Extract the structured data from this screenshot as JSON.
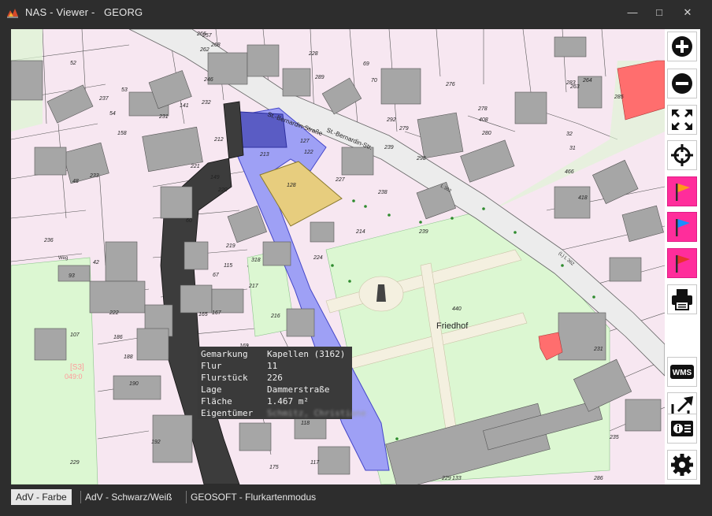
{
  "window": {
    "title": "NAS - Viewer -   GEORG",
    "minimize_glyph": "—",
    "maximize_glyph": "□",
    "close_glyph": "✕"
  },
  "map": {
    "street_label_1": "St.-Bernardin-Straße",
    "street_label_2": "St.-Bernardin-Str.",
    "road_label_1": "L 362",
    "road_label_2": "(L) L 362",
    "place_label": "Friedhof",
    "path_label": "Weg",
    "old_parcel_label_1": "[S3]",
    "old_parcel_label_2": "049:0",
    "parcel_numbers": [
      "266",
      "257",
      "268",
      "262",
      "52",
      "228",
      "69",
      "289",
      "237",
      "70",
      "276",
      "283",
      "264",
      "53",
      "246",
      "232",
      "141",
      "231",
      "279",
      "278",
      "408",
      "263",
      "285",
      "239",
      "298",
      "212",
      "127",
      "292",
      "280",
      "54",
      "158",
      "213",
      "122",
      "32",
      "31",
      "221",
      "149",
      "227",
      "238",
      "466",
      "233",
      "128",
      "220",
      "418",
      "48",
      "60",
      "239",
      "214",
      "236",
      "219",
      "318",
      "224",
      "42",
      "93",
      "115",
      "67",
      "217",
      "440",
      "222",
      "186",
      "165",
      "167",
      "216",
      "107",
      "188",
      "169",
      "231",
      "190",
      "126",
      "118",
      "192",
      "117",
      "175",
      "229",
      "229",
      "235",
      "286",
      "133"
    ]
  },
  "info_panel": {
    "rows": [
      {
        "key": "Gemarkung",
        "value": "Kapellen (3162)"
      },
      {
        "key": "Flur",
        "value": "11"
      },
      {
        "key": "Flurstück",
        "value": "226"
      },
      {
        "key": "Lage",
        "value": "Dammerstraße"
      },
      {
        "key": "Fläche",
        "value": "1.467 m²"
      },
      {
        "key": "Eigentümer",
        "value": "Schmitz, Christiane"
      }
    ]
  },
  "toolbar": {
    "buttons": [
      {
        "name": "zoom-in",
        "icon": "plus-circle-icon"
      },
      {
        "name": "zoom-out",
        "icon": "minus-circle-icon"
      },
      {
        "name": "full-extent",
        "icon": "expand-arrows-icon"
      },
      {
        "name": "locate",
        "icon": "crosshair-icon"
      },
      {
        "name": "flag-orange",
        "icon": "flag-icon",
        "color": "#ff9a1a"
      },
      {
        "name": "flag-blue",
        "icon": "flag-icon",
        "color": "#1a8cff"
      },
      {
        "name": "flag-red",
        "icon": "flag-icon",
        "color": "#e8332b"
      },
      {
        "name": "print",
        "icon": "printer-icon"
      },
      {
        "name": "wms",
        "icon": "wms-icon",
        "label": "WMS"
      },
      {
        "name": "export",
        "icon": "share-arrow-icon"
      },
      {
        "name": "info",
        "icon": "info-card-icon"
      },
      {
        "name": "settings",
        "icon": "gear-icon"
      }
    ]
  },
  "status": {
    "tabs": [
      "AdV - Farbe",
      "AdV - Schwarz/Weiß",
      "GEOSOFT - Flurkartenmodus"
    ],
    "active_tab": "AdV - Farbe"
  },
  "colors": {
    "parcel_fill": "#f7e7f1",
    "green_area": "#dcf7d2",
    "building": "#a6a6a6",
    "road": "#ececec",
    "selected_road": "#3c3c3c",
    "selected_parcel_blue": "#9ea0f5",
    "selected_parcel_yellow": "#e7cd7e",
    "highlight_building": "#ff6e6e",
    "flag_button": "#ff2d9b"
  }
}
